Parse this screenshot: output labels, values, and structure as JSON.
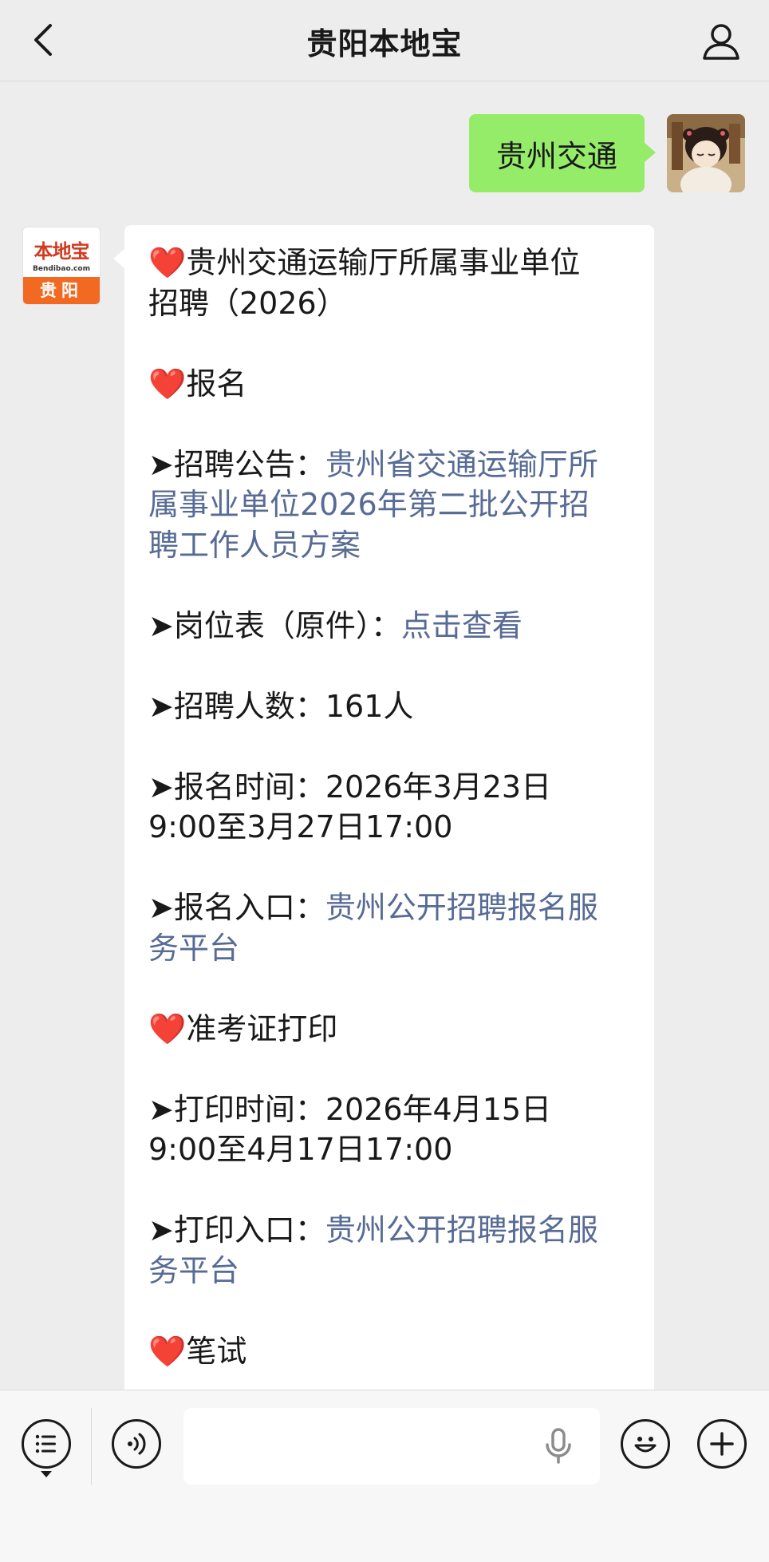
{
  "header": {
    "title": "贵阳本地宝"
  },
  "chat": {
    "outgoing_message": "贵州交通",
    "bot_avatar": {
      "logo_text": "本地宝",
      "logo_url": "Bendibao.com",
      "city": "贵阳"
    },
    "reply": {
      "title_line1": "贵州交通运输厅所属事业单位",
      "title_line2": "招聘（2026）",
      "section_signup": "报名",
      "notice_label": "➤招聘公告：",
      "notice_link_line1": "贵州省交通运输厅所",
      "notice_link_line2": "属事业单位2026年第二批公开招",
      "notice_link_line3": "聘工作人员方案",
      "positions_label": "➤岗位表（原件）：",
      "positions_link": "点击查看",
      "headcount": "➤招聘人数：161人",
      "signup_time_line1": "➤报名时间：2026年3月23日",
      "signup_time_line2": "9:00至3月27日17:00",
      "signup_entry_label": "➤报名入口：",
      "signup_entry_link_line1": "贵州公开招聘报名服",
      "signup_entry_link_line2": "务平台",
      "section_admission": "准考证打印",
      "print_time_line1": "➤打印时间：2026年4月15日",
      "print_time_line2": "9:00至4月17日17:00",
      "print_entry_label": "➤打印入口：",
      "print_entry_link_line1": "贵州公开招聘报名服",
      "print_entry_link_line2": "务平台",
      "section_exam": "笔试",
      "heart": "❤️"
    }
  },
  "input_bar": {
    "placeholder": ""
  },
  "colors": {
    "background": "#ededed",
    "outgoing_bubble": "#95ec69",
    "link": "#576b95",
    "brand_orange": "#f26a21"
  },
  "icons": [
    "back-arrow-icon",
    "person-icon",
    "menu-list-icon",
    "voice-icon",
    "microphone-icon",
    "emoji-icon",
    "plus-icon"
  ]
}
